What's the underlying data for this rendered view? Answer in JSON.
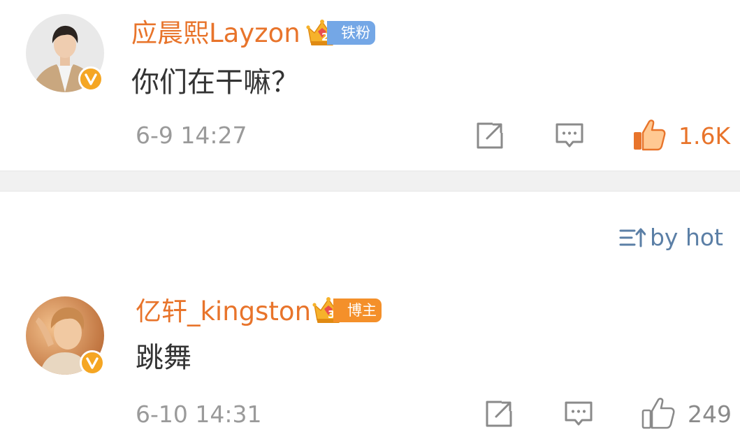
{
  "colors": {
    "username": "#e8742b",
    "text": "#333333",
    "meta": "#9a9a9a",
    "liked": "#e8742b",
    "link": "#5b7fa6",
    "divider": "#f1f1f1",
    "badge_fan": "#74a7e6",
    "badge_host": "#f4902a",
    "verify": "#f5a623"
  },
  "sort": {
    "icon": "sort-icon",
    "label": "by hot"
  },
  "posts": [
    {
      "username": "应晨熙Layzon",
      "crown_level": "2",
      "badge": "铁粉",
      "content": "你们在干嘛？",
      "time": "6-9 14:27",
      "likes": "1.6K",
      "liked": true,
      "verify_icon": "verified-v-icon",
      "share_icon": "share-icon",
      "comment_icon": "comment-icon",
      "like_icon": "thumbs-up-icon"
    },
    {
      "username": "亿轩_kingston",
      "crown_level": "3",
      "badge": "博主",
      "content": "跳舞",
      "time": "6-10 14:31",
      "likes": "249",
      "liked": false,
      "verify_icon": "verified-v-icon",
      "share_icon": "share-icon",
      "comment_icon": "comment-icon",
      "like_icon": "thumbs-up-icon"
    }
  ]
}
